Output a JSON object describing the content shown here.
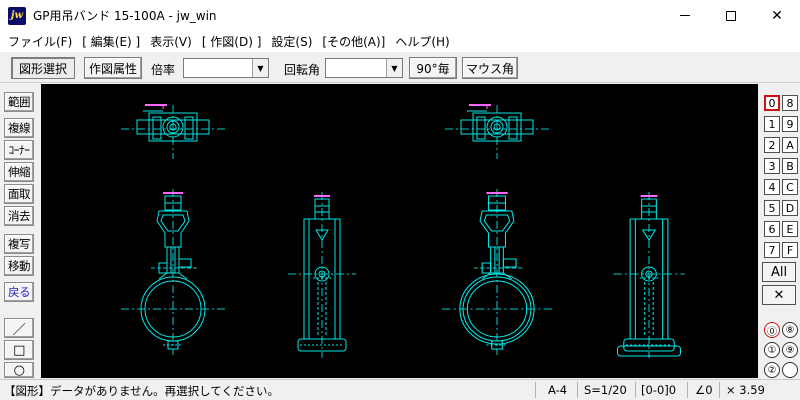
{
  "window": {
    "title": "GP用吊バンド 15-100A - jw_win",
    "app_icon": "jw"
  },
  "menu": [
    "ファイル(F)",
    "[ 編集(E) ]",
    "表示(V)",
    "[ 作図(D) ]",
    "設定(S)",
    "[その他(A)]",
    "ヘルプ(H)"
  ],
  "toolbar": {
    "select_label": "図形選択",
    "attr_label": "作図属性",
    "scale_label": "倍率",
    "scale_value": "",
    "rotation_label": "回転角",
    "rotation_value": "",
    "ninety_label": "90°毎",
    "mouse_angle_label": "マウス角"
  },
  "left_tools": [
    "範囲",
    "複線",
    "ｺｰﾅｰ",
    "伸縮",
    "面取",
    "消去",
    "複写",
    "移動",
    "戻る"
  ],
  "shape_tools": {
    "line_glyph": "／",
    "rect_glyph": "□",
    "circle_glyph": "○"
  },
  "layers": {
    "left_col": [
      "0",
      "1",
      "2",
      "3",
      "4",
      "5",
      "6",
      "7"
    ],
    "right_col": [
      "8",
      "9",
      "A",
      "B",
      "C",
      "D",
      "E",
      "F"
    ],
    "all_label": "All",
    "cross_glyph": "✕",
    "group_left": [
      "⓪",
      "①",
      "②"
    ],
    "group_right": [
      "⑧",
      "⑨",
      ""
    ]
  },
  "status": {
    "message": "【図形】データがありません。再選択してください。",
    "paper": "A-4",
    "scale": "S=1/20",
    "layer": "[0-0]0",
    "angle": "∠0",
    "zoom": "× 3.59"
  },
  "colors": {
    "canvas_bg": "#000000",
    "line_primary": "#00e6e6",
    "line_center": "#00c8c8",
    "line_accent": "#ff66ff",
    "active_layer": "#d01010"
  }
}
